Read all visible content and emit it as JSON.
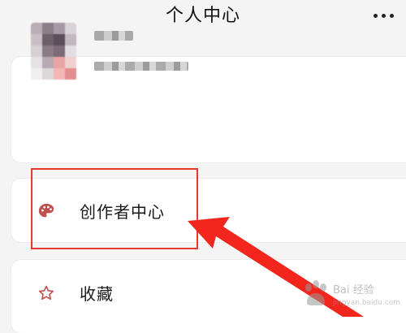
{
  "header": {
    "title": "个人中心"
  },
  "menu": {
    "items": [
      {
        "label": "创作者中心",
        "icon": "palette-icon"
      },
      {
        "label": "收藏",
        "icon": "star-icon"
      }
    ]
  },
  "watermark": {
    "text": "Bai 经验",
    "sub": "jingyan.baidu.com"
  },
  "colors": {
    "highlight": "#e8372f",
    "palette_icon": "#c0504d",
    "star_outline": "#c0504d"
  }
}
